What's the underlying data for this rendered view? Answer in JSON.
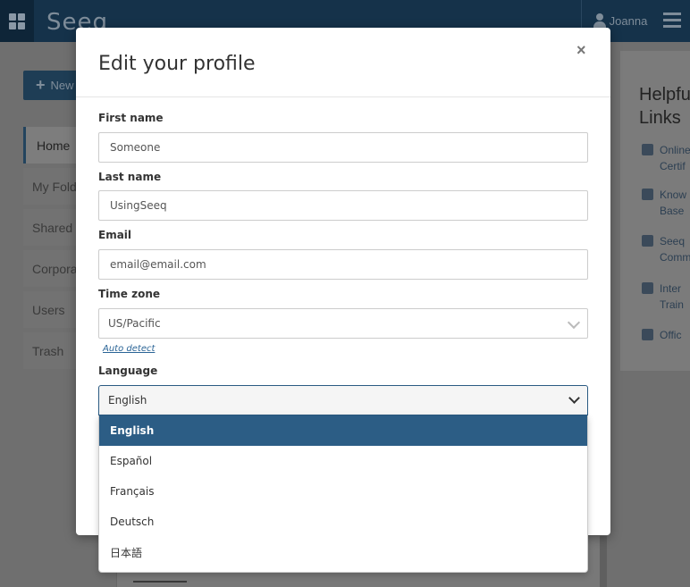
{
  "app": {
    "logo_text": "Seeq",
    "user_name": "Joanna",
    "new_button_label": "New",
    "nav_items": [
      {
        "label": "Home"
      },
      {
        "label": "My Folder"
      },
      {
        "label": "Shared"
      },
      {
        "label": "Corporate"
      },
      {
        "label": "Users"
      },
      {
        "label": "Trash"
      }
    ],
    "help": {
      "title": "Helpful Links",
      "links": [
        {
          "label": "Online Certif",
          "icon": "ribbon-icon"
        },
        {
          "label": "Know Base",
          "icon": "book-icon"
        },
        {
          "label": "Seeq Comm",
          "icon": "chat-icon"
        },
        {
          "label": "Inter Train",
          "icon": "graduation-cap-icon"
        },
        {
          "label": "Offic",
          "icon": "headset-icon"
        }
      ]
    }
  },
  "modal": {
    "title": "Edit your profile",
    "close_label": "×",
    "fields": {
      "first_name": {
        "label": "First name",
        "value": "Someone"
      },
      "last_name": {
        "label": "Last name",
        "value": "UsingSeeq"
      },
      "email": {
        "label": "Email",
        "value": "email@email.com"
      },
      "time_zone": {
        "label": "Time zone",
        "value": "US/Pacific"
      },
      "auto_detect": "Auto detect",
      "language": {
        "label": "Language",
        "value": "English"
      }
    },
    "language_options": [
      "English",
      "Español",
      "Français",
      "Deutsch",
      "日本語"
    ]
  },
  "colors": {
    "topbar": "#15324a",
    "selected_option": "#2c5d85"
  }
}
